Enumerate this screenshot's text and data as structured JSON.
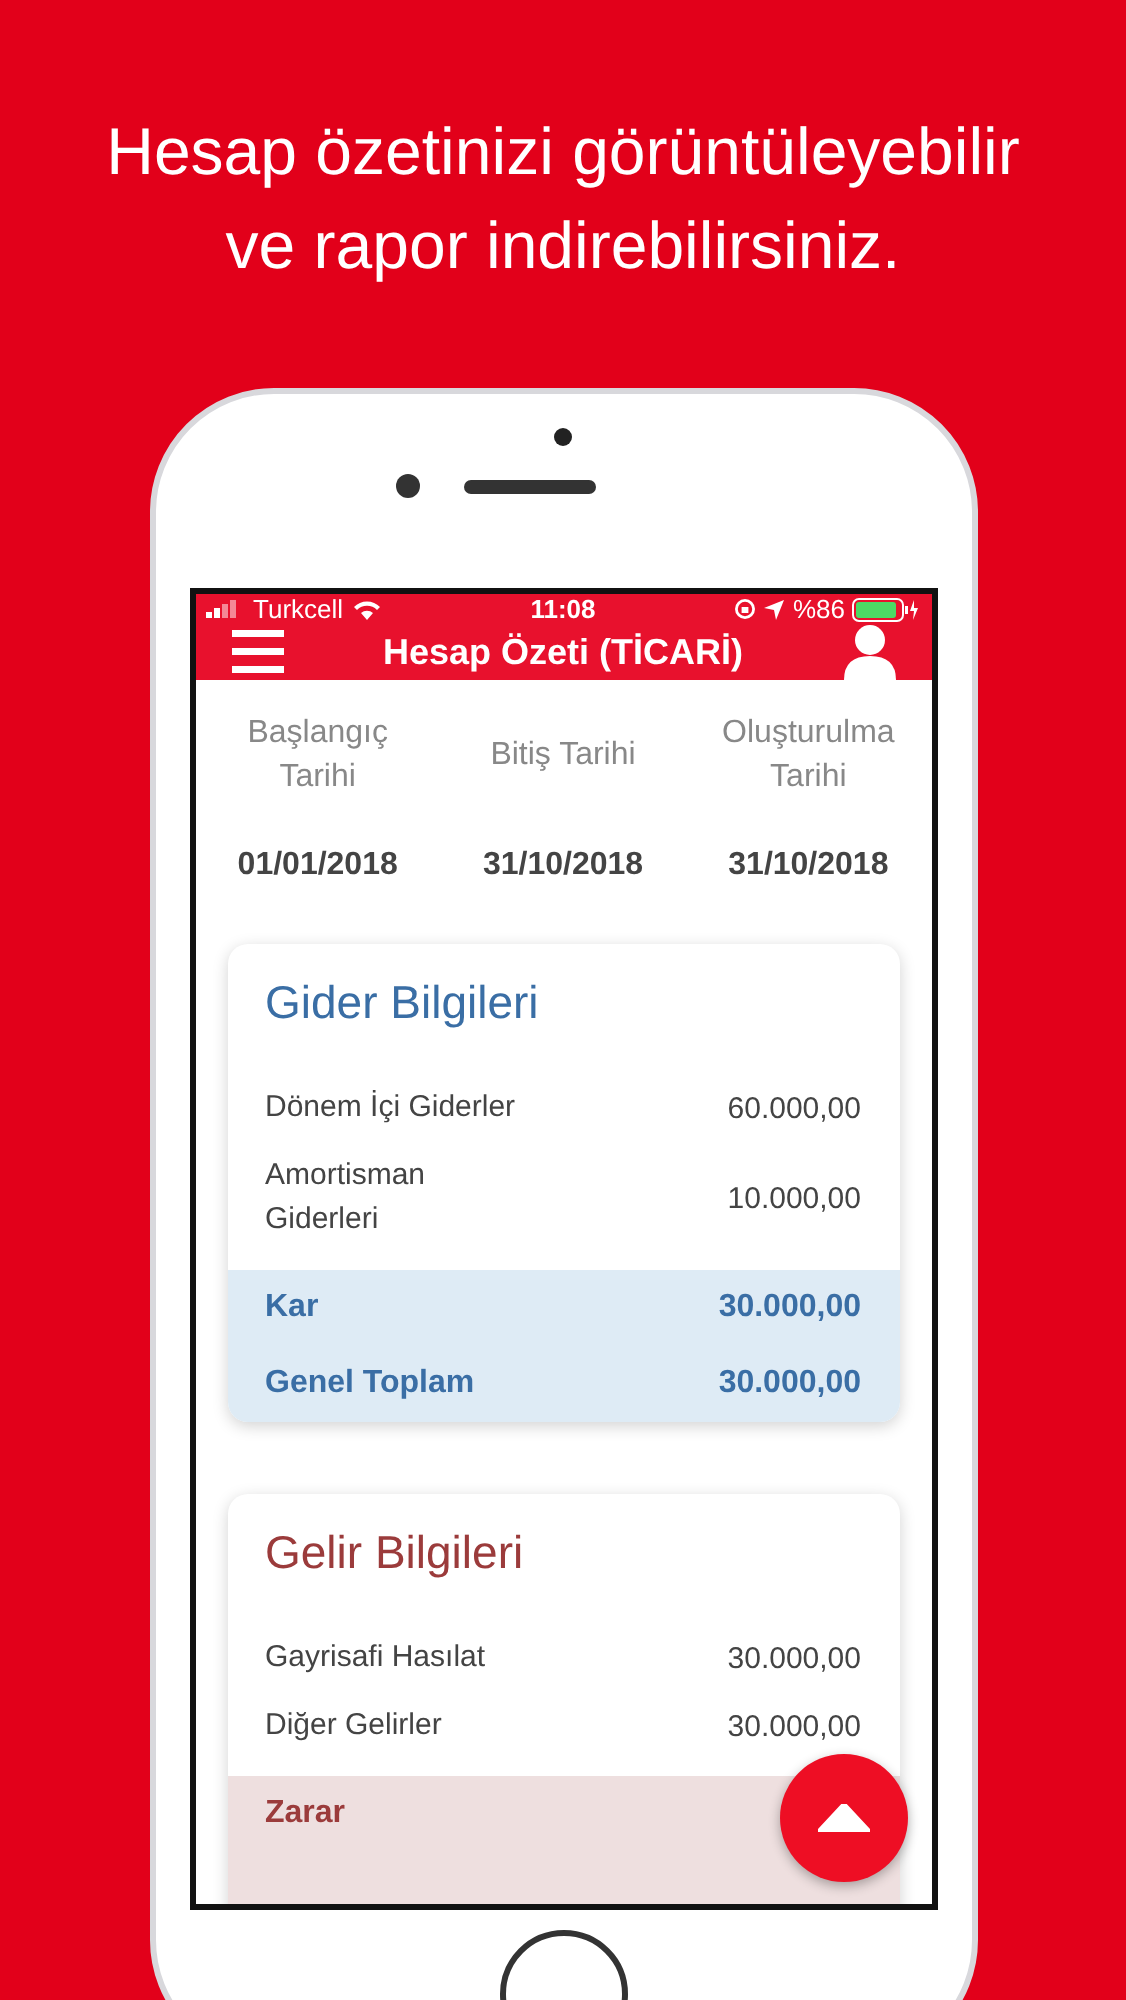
{
  "headline": "Hesap özetinizi görüntüleyebilir ve rapor indirebilirsiniz.",
  "status_bar": {
    "carrier": "Turkcell",
    "time": "11:08",
    "battery": "%86"
  },
  "nav": {
    "title": "Hesap Özeti (TİCARİ)"
  },
  "dates": [
    {
      "label": "Başlangıç Tarihi",
      "value": "01/01/2018"
    },
    {
      "label": "Bitiş Tarihi",
      "value": "31/10/2018"
    },
    {
      "label": "Oluşturulma Tarihi",
      "value": "31/10/2018"
    }
  ],
  "cards": [
    {
      "title": "Gider Bilgileri",
      "kind": "expense",
      "rows": [
        {
          "label": "Dönem İçi Giderler",
          "value": "60.000,00",
          "kind": "item"
        },
        {
          "label": "Amortisman Giderleri",
          "value": "10.000,00",
          "kind": "item"
        },
        {
          "label": "Kar",
          "value": "30.000,00",
          "kind": "total"
        },
        {
          "label": "Genel Toplam",
          "value": "30.000,00",
          "kind": "total"
        }
      ]
    },
    {
      "title": "Gelir Bilgileri",
      "kind": "income",
      "rows": [
        {
          "label": "Gayrisafi Hasılat",
          "value": "30.000,00",
          "kind": "item"
        },
        {
          "label": "Diğer Gelirler",
          "value": "30.000,00",
          "kind": "item"
        },
        {
          "label": "Zarar",
          "kind": "total"
        }
      ]
    }
  ]
}
